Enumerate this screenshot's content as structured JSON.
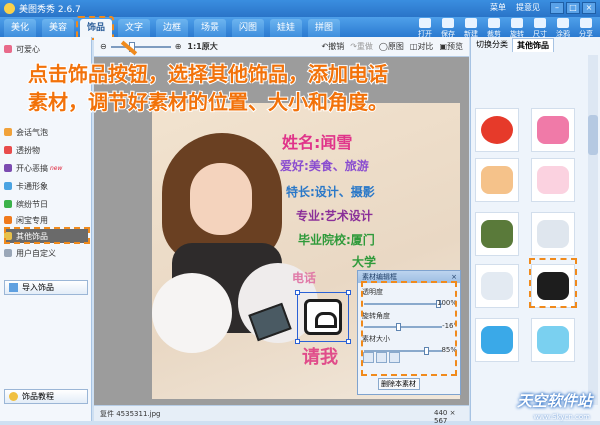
{
  "app": {
    "title": "美图秀秀 2.6.7",
    "top_links": [
      "菜单",
      "提意见"
    ]
  },
  "menu_tabs": [
    "美化",
    "美容",
    "饰品",
    "文字",
    "边框",
    "场景",
    "闪图",
    "娃娃",
    "拼图"
  ],
  "active_tab": "饰品",
  "right_tools": [
    "打开",
    "保存",
    "新建",
    "裁剪",
    "旋转",
    "尺寸",
    "涂鸦",
    "分享"
  ],
  "sidebar": {
    "items": [
      "可爱心",
      "",
      "",
      "",
      "",
      "",
      "会话气泡",
      "透扮物",
      "开心恶搞",
      "卡通形象",
      "缤纷节日",
      "闲宝专用",
      "其他饰品",
      "用户自定义"
    ],
    "new_badge": "new",
    "import_label": "导入饰品",
    "tutorial_label": "饰品教程"
  },
  "toolbar": {
    "zoom_label": "1:1原大",
    "undo": "撤销",
    "redo": "重做",
    "original": "原图",
    "compare": "对比",
    "preview": "预览"
  },
  "right_panel": {
    "tab_category": "切换分类",
    "tab_other": "其他饰品"
  },
  "photo_texts": [
    "姓名:闻雪",
    "爱好:美食、旅游",
    "特长:设计、摄影",
    "专业:艺术设计",
    "毕业院校:厦门",
    "大学",
    "电话",
    "请我"
  ],
  "edit_panel": {
    "title": "素材编辑框",
    "opacity_label": "透明度",
    "opacity_value": "100%",
    "rotate_label": "旋转角度",
    "rotate_value": "-16°",
    "size_label": "素材大小",
    "size_value": "85%",
    "delete_label": "删除本素材"
  },
  "status": {
    "file": "复件 4535311.jpg",
    "dimensions": "440 × 567"
  },
  "overlay": {
    "line1": "点击饰品按钮，选择其他饰品，添加电话",
    "line2": "素材，调节好素材的位置、大小和角度。"
  },
  "watermark": {
    "main": "天空软件站",
    "sub": "www.Skycn.com"
  },
  "colors": {
    "accent": "#f08a1c",
    "menu_blue": "#2b7ad0",
    "overlay_text": "#f2720a"
  }
}
